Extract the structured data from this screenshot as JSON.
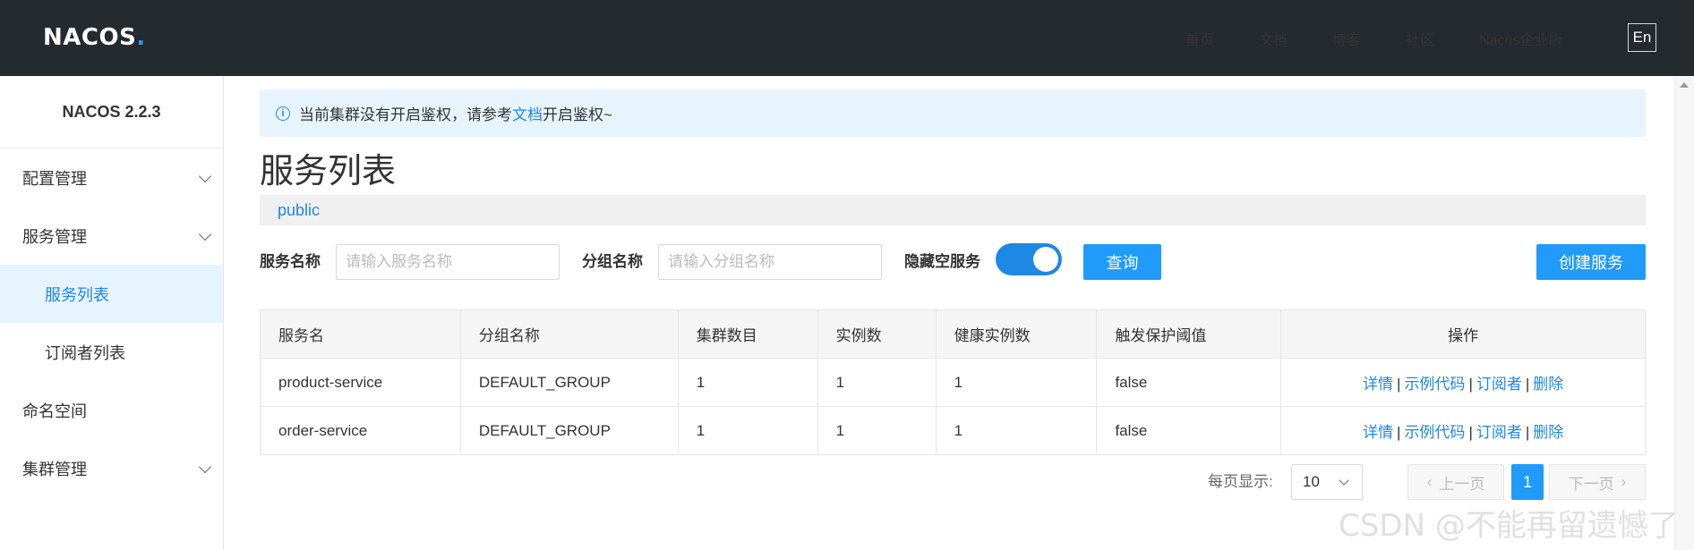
{
  "header": {
    "logo_main": "NACOS",
    "logo_dot": ".",
    "nav": [
      "首页",
      "文档",
      "博客",
      "社区",
      "Nacos企业版"
    ],
    "lang": "En"
  },
  "sidebar": {
    "version": "NACOS 2.2.3",
    "items": [
      {
        "label": "配置管理",
        "expandable": true
      },
      {
        "label": "服务管理",
        "expandable": true
      },
      {
        "label": "服务列表",
        "sub": true,
        "active": true
      },
      {
        "label": "订阅者列表",
        "sub": true
      },
      {
        "label": "命名空间"
      },
      {
        "label": "集群管理",
        "expandable": true
      }
    ]
  },
  "alert": {
    "prefix": "当前集群没有开启鉴权，请参考",
    "link": "文档",
    "suffix": "开启鉴权~"
  },
  "page_title": "服务列表",
  "namespace": "public",
  "filter": {
    "service_label": "服务名称",
    "service_placeholder": "请输入服务名称",
    "group_label": "分组名称",
    "group_placeholder": "请输入分组名称",
    "hide_empty_label": "隐藏空服务",
    "hide_empty_on": true,
    "query_button": "查询",
    "create_button": "创建服务"
  },
  "table": {
    "headers": [
      "服务名",
      "分组名称",
      "集群数目",
      "实例数",
      "健康实例数",
      "触发保护阈值",
      "操作"
    ],
    "rows": [
      {
        "name": "product-service",
        "group": "DEFAULT_GROUP",
        "clusters": "1",
        "instances": "1",
        "healthy": "1",
        "protect": "false"
      },
      {
        "name": "order-service",
        "group": "DEFAULT_GROUP",
        "clusters": "1",
        "instances": "1",
        "healthy": "1",
        "protect": "false"
      }
    ],
    "ops": [
      "详情",
      "示例代码",
      "订阅者",
      "删除"
    ]
  },
  "pagination": {
    "page_size_label": "每页显示:",
    "page_size": "10",
    "prev": "上一页",
    "next": "下一页",
    "current_page": "1"
  },
  "watermark": "CSDN @不能再留遗憾了",
  "colors": {
    "primary": "#209bfa",
    "header_bg": "#252a2f",
    "link": "#1e88e5"
  }
}
